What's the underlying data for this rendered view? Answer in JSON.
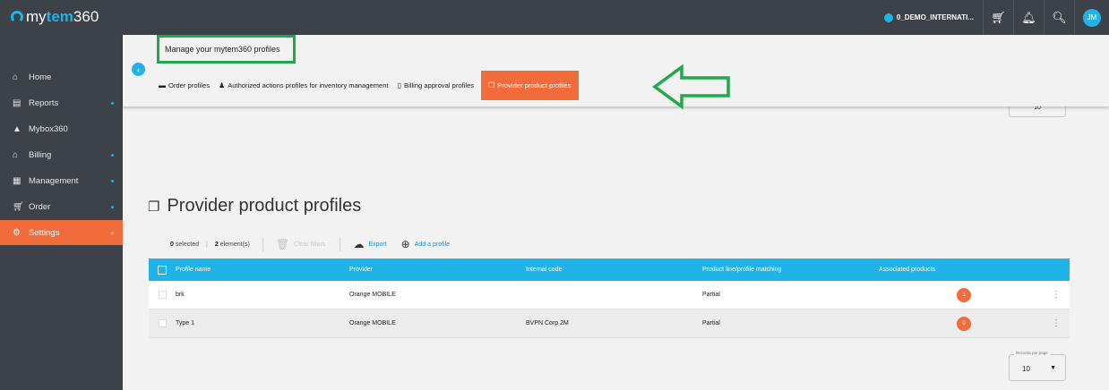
{
  "app": {
    "logo_prefix": "my",
    "logo_brand": "tem",
    "logo_suffix": "360"
  },
  "topbar": {
    "account": "0_DEMO_INTERNATI...",
    "avatar_initials": "JM"
  },
  "sidebar": {
    "items": [
      {
        "label": "Home",
        "icon": "home-icon"
      },
      {
        "label": "Reports",
        "icon": "reports-icon"
      },
      {
        "label": "Mybox360",
        "icon": "mybox-icon"
      },
      {
        "label": "Billing",
        "icon": "billing-icon"
      },
      {
        "label": "Management",
        "icon": "management-icon"
      },
      {
        "label": "Order",
        "icon": "cart-icon"
      },
      {
        "label": "Settings",
        "icon": "settings-icon"
      }
    ]
  },
  "header": {
    "title": "Manage your mytem360 profiles",
    "tabs": [
      {
        "label": "Order profiles"
      },
      {
        "label": "Authorized actions profiles for inventory management"
      },
      {
        "label": "Billing approval profiles"
      },
      {
        "label": "Provider product profiles",
        "active": true
      }
    ]
  },
  "top_records_value": "10",
  "page": {
    "title": "Provider product profiles"
  },
  "toolbar": {
    "selected_count": "0",
    "selected_label": "selected",
    "element_count": "2",
    "element_label": "element(s)",
    "clear_filters": "Clear filters",
    "export": "Export",
    "add_profile": "Add a profile"
  },
  "table": {
    "columns": [
      "Profile name",
      "Provider",
      "Internal code",
      "Product line/profile matching",
      "Associated products"
    ],
    "rows": [
      {
        "name": "brk",
        "provider": "Orange MOBILE",
        "internal_code": "",
        "matching": "Partial",
        "associated": "1"
      },
      {
        "name": "Type 1",
        "provider": "Orange MOBILE",
        "internal_code": "BVPN Corp 2M",
        "matching": "Partial",
        "associated": "0"
      }
    ]
  },
  "pagination": {
    "records_label": "Records per page",
    "records_value": "10"
  },
  "colors": {
    "accent": "#1fb3e8",
    "active": "#f26b3a",
    "highlight_box": "#21a84a",
    "sidebar_bg": "#3c4248"
  }
}
